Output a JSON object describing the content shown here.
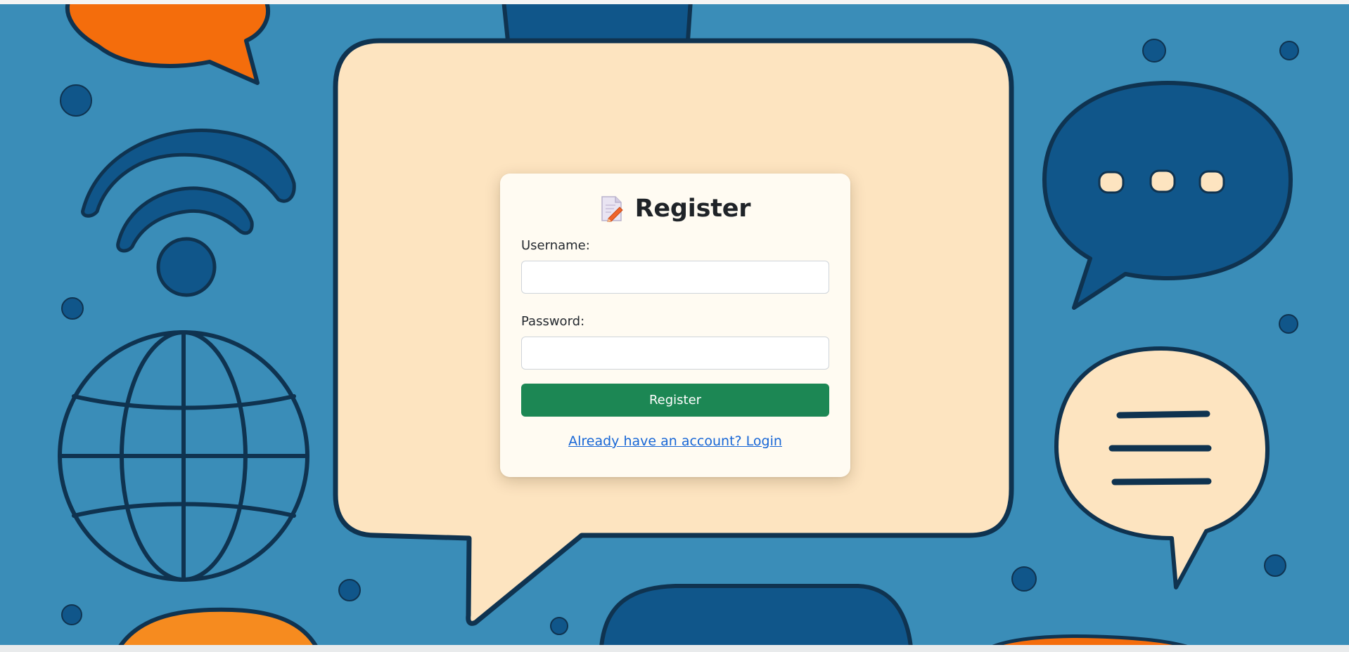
{
  "colors": {
    "background_blue": "#3a8db8",
    "deep_blue": "#0e5b8c",
    "outline_navy": "#0f3350",
    "cream": "#fde4c0",
    "orange": "#f46d0c",
    "card_bg": "#fffbf4",
    "button_green": "#1c8754",
    "link_blue": "#1766d6"
  },
  "register": {
    "icon": "memo-pencil-icon",
    "title": "Register",
    "username_label": "Username:",
    "username_value": "",
    "password_label": "Password:",
    "password_value": "",
    "submit_label": "Register",
    "login_link": "Already have an account? Login"
  },
  "background_icons": [
    "orange-speech-bubble-icon",
    "wifi-icon",
    "globe-icon",
    "typing-speech-bubble-icon",
    "text-speech-bubble-icon",
    "large-cream-speech-bubble"
  ]
}
